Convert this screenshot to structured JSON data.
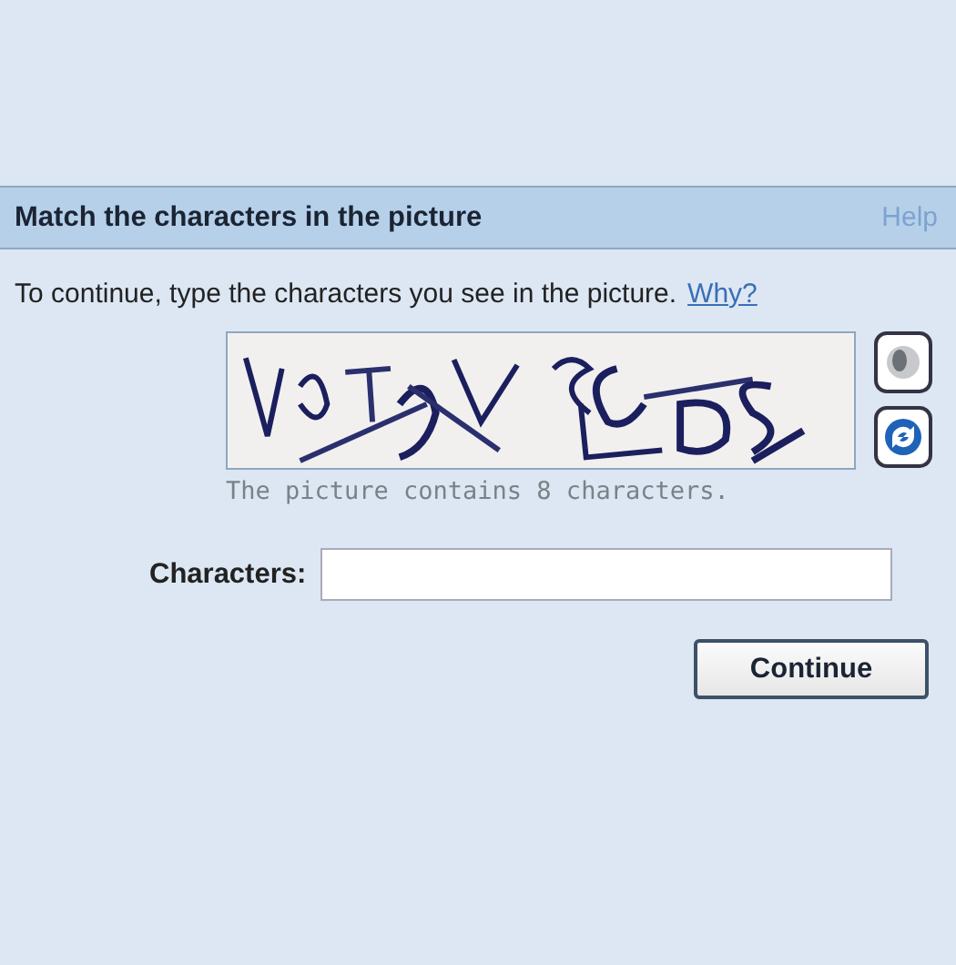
{
  "header": {
    "title": "Match the characters in the picture",
    "help_link": "Help"
  },
  "instruction": {
    "text": "To continue, type the characters you see in the picture.",
    "link": "Why?"
  },
  "captcha": {
    "kind": "picture",
    "caption": "The picture contains 8 characters."
  },
  "form": {
    "label": "Characters:"
  },
  "buttons": [
    "Continue"
  ]
}
